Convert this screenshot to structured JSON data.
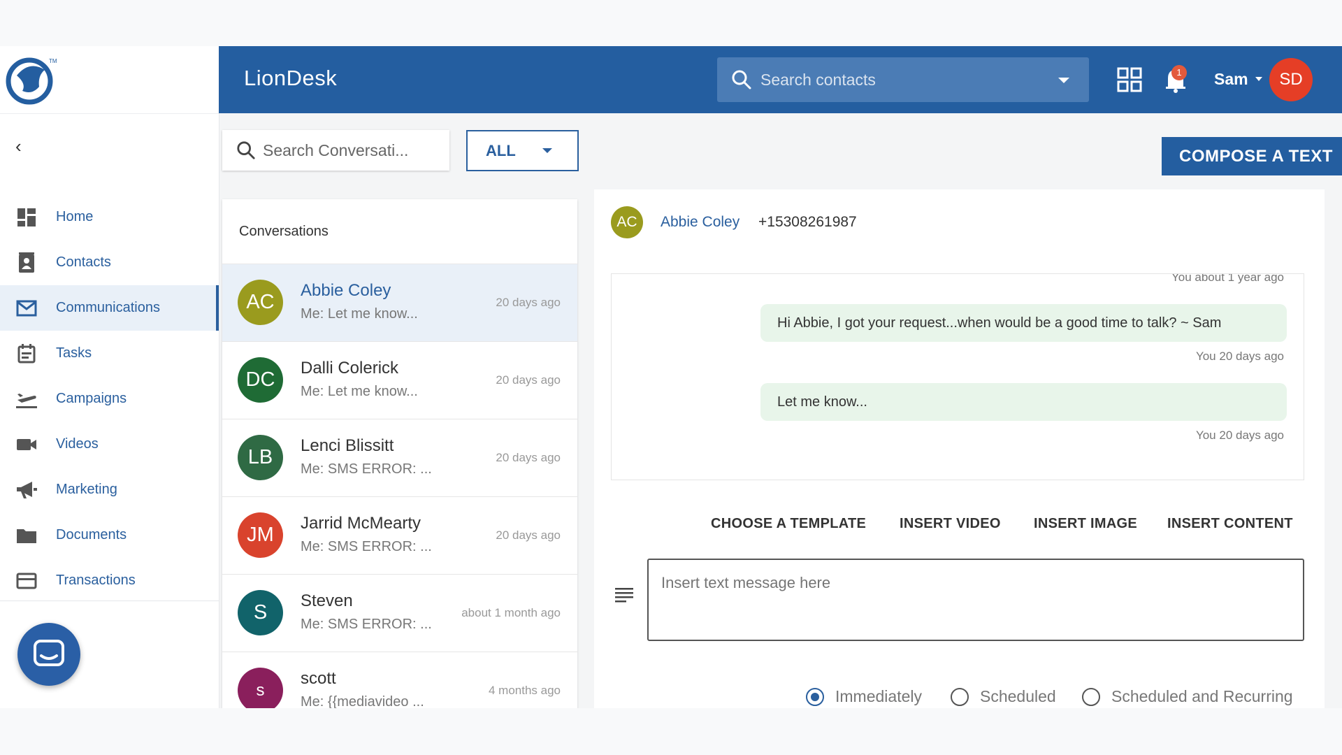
{
  "header": {
    "brand": "LionDesk",
    "search_placeholder": "Search contacts",
    "notification_count": "1",
    "user_name": "Sam",
    "user_initials": "SD"
  },
  "sidebar": {
    "items": [
      {
        "label": "Home",
        "icon": "dashboard-icon"
      },
      {
        "label": "Contacts",
        "icon": "contacts-icon"
      },
      {
        "label": "Communications",
        "icon": "mail-icon",
        "active": true
      },
      {
        "label": "Tasks",
        "icon": "tasks-icon"
      },
      {
        "label": "Campaigns",
        "icon": "plane-icon"
      },
      {
        "label": "Videos",
        "icon": "video-icon"
      },
      {
        "label": "Marketing",
        "icon": "megaphone-icon"
      },
      {
        "label": "Documents",
        "icon": "folder-icon"
      },
      {
        "label": "Transactions",
        "icon": "card-icon"
      }
    ]
  },
  "conversations": {
    "search_placeholder": "Search Conversati...",
    "filter_label": "ALL",
    "heading": "Conversations",
    "items": [
      {
        "initials": "AC",
        "name": "Abbie Coley",
        "preview": "Me: Let me know...",
        "time": "20 days ago",
        "color": "#9a9b1e"
      },
      {
        "initials": "DC",
        "name": "Dalli Colerick",
        "preview": "Me: Let me know...",
        "time": "20 days ago",
        "color": "#1f6b35"
      },
      {
        "initials": "LB",
        "name": "Lenci Blissitt",
        "preview": "Me: SMS ERROR: ...",
        "time": "20 days ago",
        "color": "#2f6a44"
      },
      {
        "initials": "JM",
        "name": "Jarrid McMearty",
        "preview": "Me: SMS ERROR: ...",
        "time": "20 days ago",
        "color": "#d9432d"
      },
      {
        "initials": "S",
        "name": "Steven",
        "preview": "Me: SMS ERROR: ...",
        "time": "about 1 month ago",
        "color": "#11636a"
      },
      {
        "initials": "s",
        "name": "scott",
        "preview": "Me: {{mediavideo ...",
        "time": "4 months ago",
        "color": "#8a1f5c"
      }
    ]
  },
  "compose_label": "COMPOSE A TEXT",
  "thread": {
    "initials": "AC",
    "name": "Abbie Coley",
    "phone": "+15308261987",
    "top_meta": "You about 1 year ago",
    "messages": [
      {
        "text": "Hi Abbie, I got your request...when would be a good time to talk? ~ Sam",
        "meta": "You 20 days ago"
      },
      {
        "text": "Let me know...",
        "meta": "You 20 days ago"
      }
    ],
    "actions": [
      "CHOOSE A TEMPLATE",
      "INSERT VIDEO",
      "INSERT IMAGE",
      "INSERT CONTENT"
    ],
    "input_placeholder": "Insert text message here",
    "schedule": [
      "Immediately",
      "Scheduled",
      "Scheduled and Recurring"
    ],
    "schedule_selected": "Immediately"
  }
}
